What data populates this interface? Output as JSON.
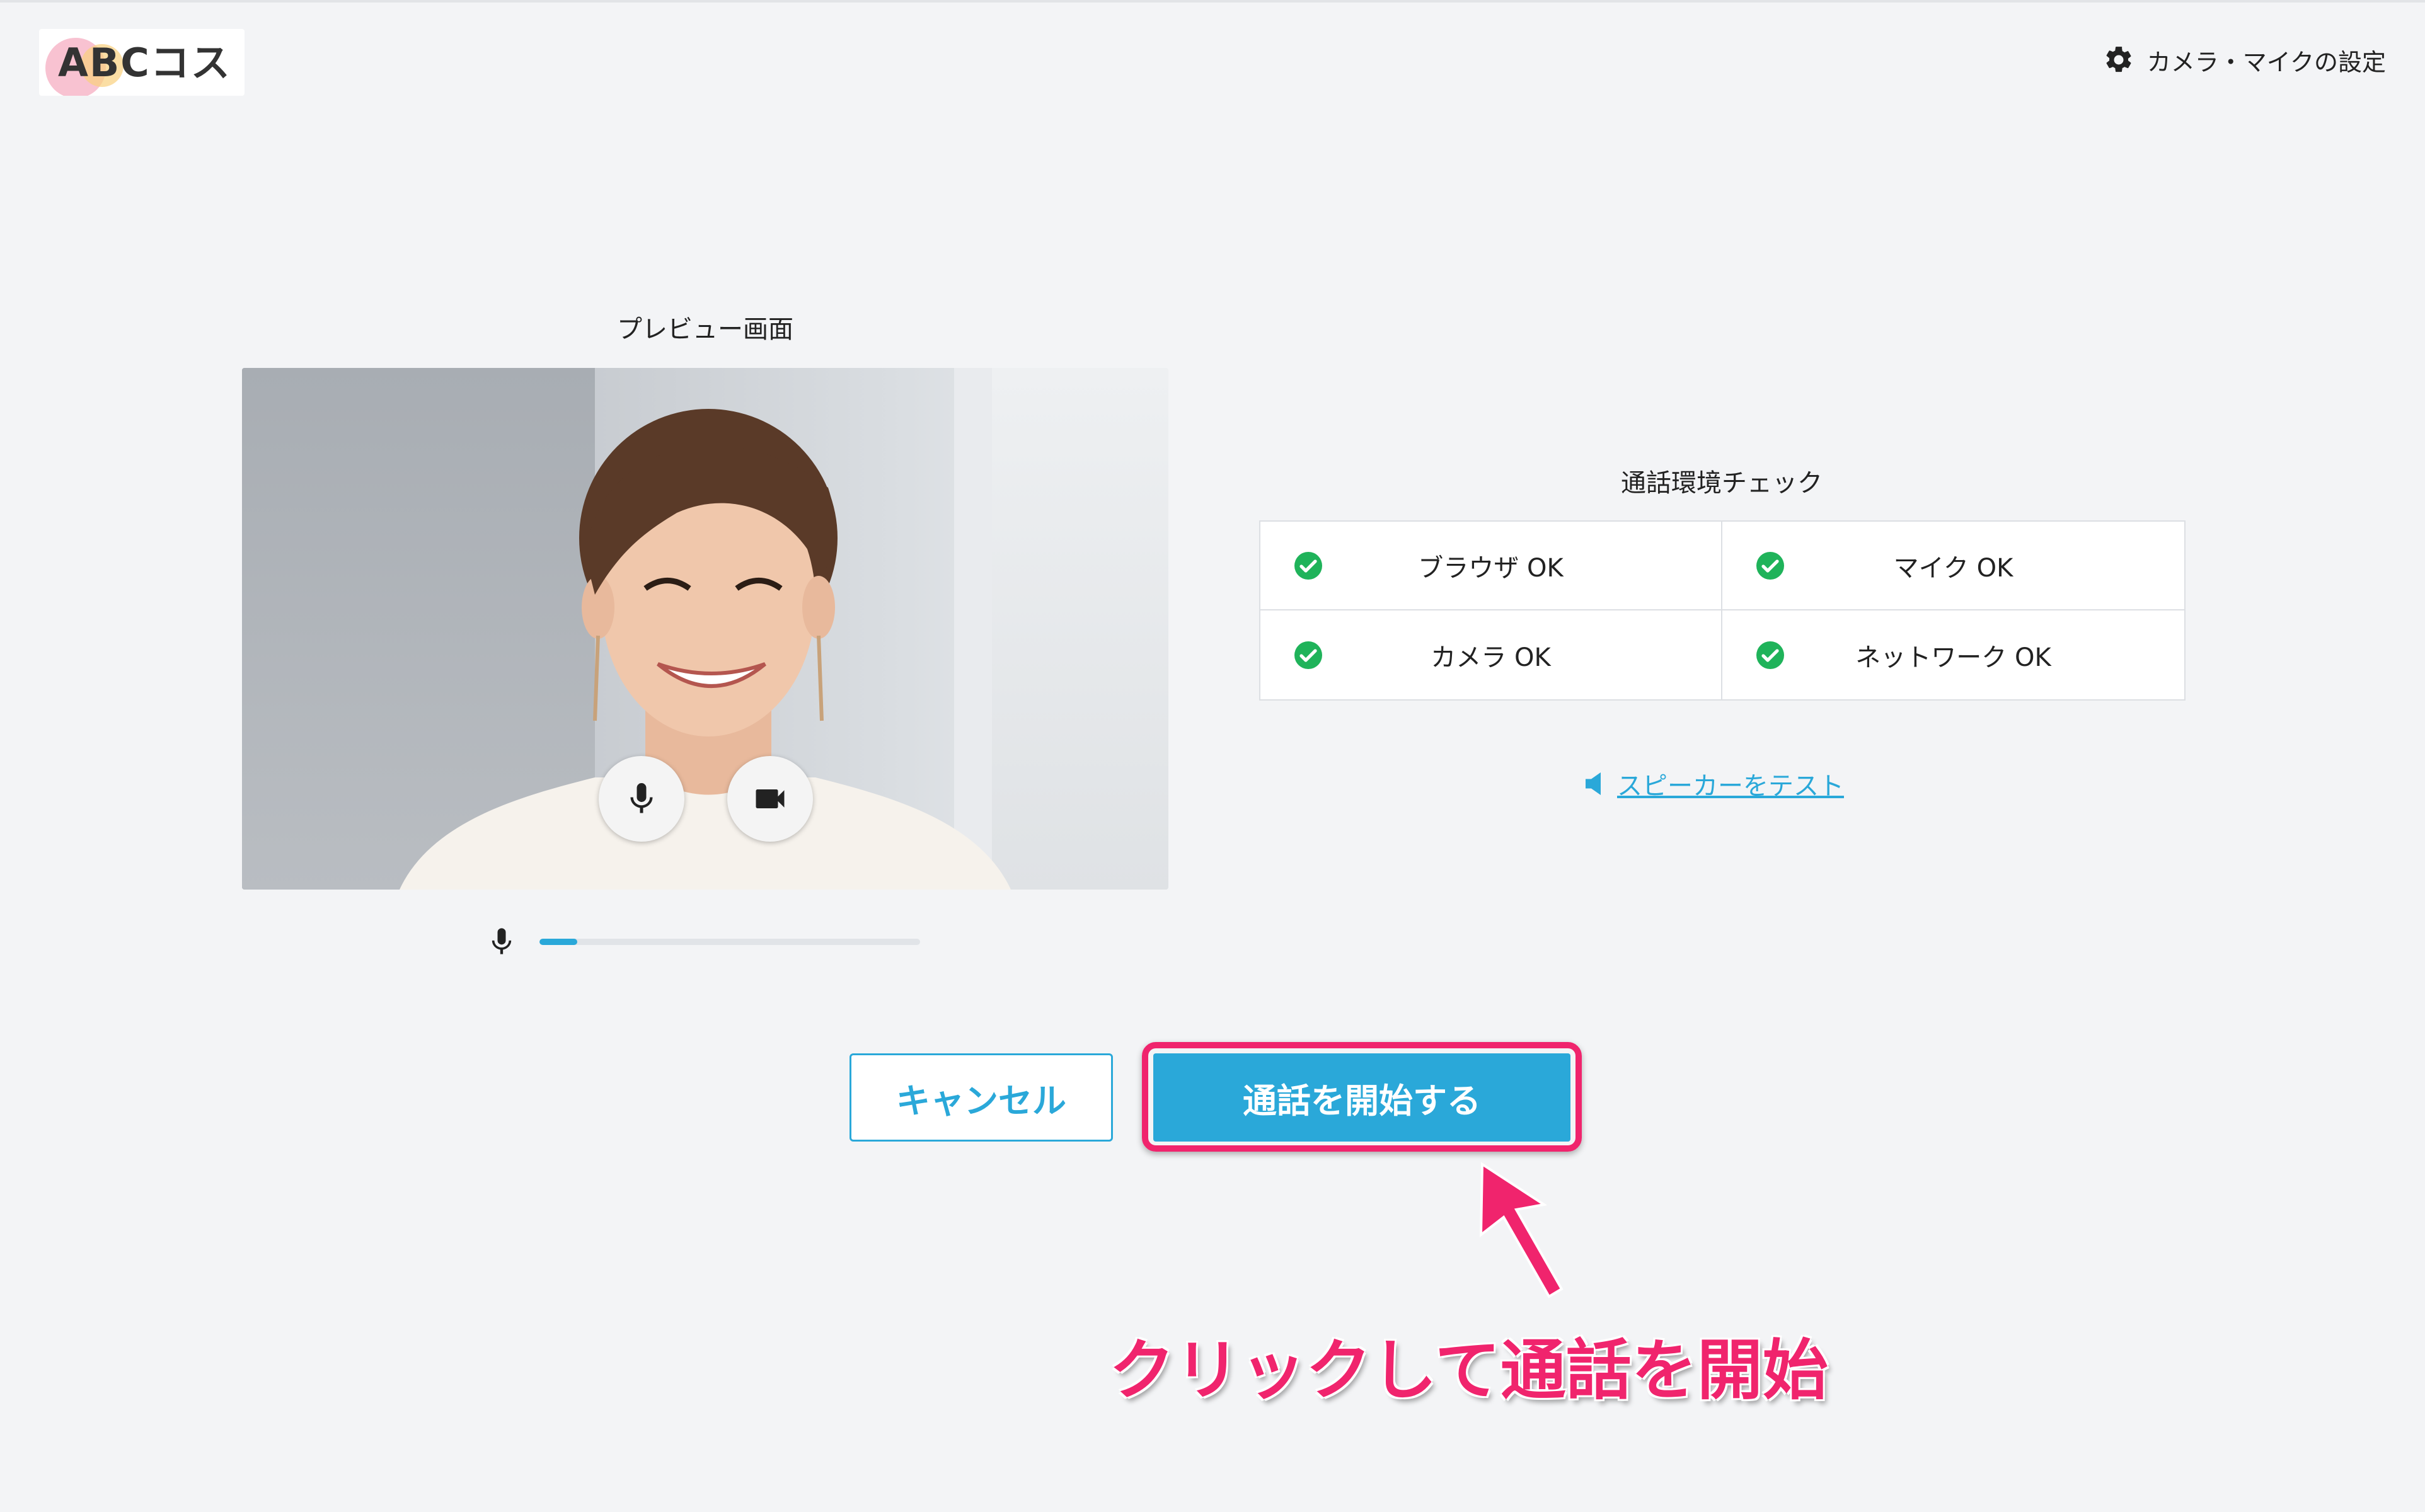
{
  "header": {
    "logo_text": "ABCコスメ",
    "settings_label": "カメラ・マイクの設定",
    "settings_icon": "gear-icon"
  },
  "preview": {
    "title": "プレビュー画面",
    "mic_button_icon": "mic-icon",
    "camera_button_icon": "video-camera-icon",
    "mic_level_fraction": 0.1
  },
  "environment_check": {
    "title": "通話環境チェック",
    "items": [
      {
        "label": "ブラウザ OK",
        "status": "ok"
      },
      {
        "label": "マイク OK",
        "status": "ok"
      },
      {
        "label": "カメラ OK",
        "status": "ok"
      },
      {
        "label": "ネットワーク OK",
        "status": "ok"
      }
    ],
    "speaker_test_label": "スピーカーをテスト"
  },
  "actions": {
    "cancel_label": "キャンセル",
    "start_label": "通話を開始する"
  },
  "annotation": {
    "text": "クリックして通話を開始"
  },
  "colors": {
    "accent": "#2aa8d9",
    "ok_green": "#1fb35a",
    "highlight_pink": "#f0246d",
    "background": "#f3f4f6"
  }
}
